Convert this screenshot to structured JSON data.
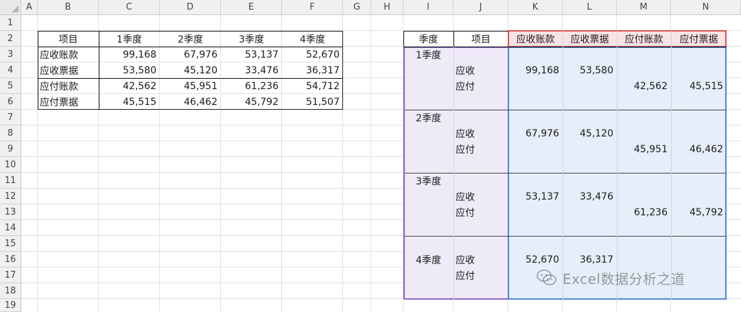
{
  "columns": [
    "A",
    "B",
    "C",
    "D",
    "E",
    "F",
    "G",
    "H",
    "I",
    "J",
    "K",
    "L",
    "M",
    "N"
  ],
  "rows": [
    "1",
    "2",
    "3",
    "4",
    "5",
    "6",
    "7",
    "8",
    "9",
    "10",
    "11",
    "12",
    "13",
    "14",
    "15",
    "16",
    "17",
    "18",
    "19"
  ],
  "left_table": {
    "headers": [
      "项目",
      "1季度",
      "2季度",
      "3季度",
      "4季度"
    ],
    "rows": [
      {
        "label": "应收账款",
        "values": [
          "99,168",
          "67,976",
          "53,137",
          "52,670"
        ]
      },
      {
        "label": "应收票据",
        "values": [
          "53,580",
          "45,120",
          "33,476",
          "36,317"
        ]
      },
      {
        "label": "应付账款",
        "values": [
          "42,562",
          "45,951",
          "61,236",
          "54,712"
        ]
      },
      {
        "label": "应付票据",
        "values": [
          "45,515",
          "46,462",
          "45,792",
          "51,507"
        ]
      }
    ]
  },
  "right_table": {
    "headers": {
      "season": "季度",
      "item": "项目",
      "k": "应收账款",
      "l": "应收票据",
      "m": "应付账款",
      "n": "应付票据"
    },
    "r3_i": "1季度",
    "r4_j": "应收",
    "r4_k": "99,168",
    "r4_l": "53,580",
    "r5_j": "应付",
    "r5_m": "42,562",
    "r5_n": "45,515",
    "r7_i": "2季度",
    "r8_j": "应收",
    "r8_k": "67,976",
    "r8_l": "45,120",
    "r9_j": "应付",
    "r9_m": "45,951",
    "r9_n": "46,462",
    "r11_i": "3季度",
    "r12_j": "应收",
    "r12_k": "53,137",
    "r12_l": "33,476",
    "r13_j": "应付",
    "r13_m": "61,236",
    "r13_n": "45,792",
    "r16_i": "4季度",
    "r16_j": "应收",
    "r16_k": "52,670",
    "r16_l": "36,317",
    "r17_j": "应付"
  },
  "watermark": "Excel数据分析之道",
  "colors": {
    "purple_fill": "#efeaf7",
    "purple_border": "#8a63c9",
    "blue_fill": "#e6eefa",
    "blue_border": "#4a86d4",
    "red_fill": "#f8e3e3",
    "red_border": "#d9534f"
  }
}
